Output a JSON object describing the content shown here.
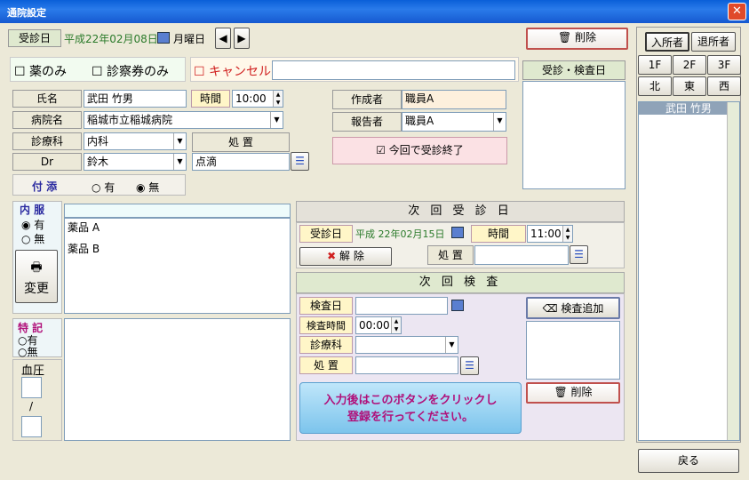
{
  "window": {
    "title": "通院設定",
    "close": "✕"
  },
  "header": {
    "visit_label": "受診日",
    "visit_date": "平成22年02月08日",
    "weekday": "月曜日",
    "prev": "◀",
    "next": "▶",
    "delete_label": "削除"
  },
  "checks": {
    "drug_only": "薬のみ",
    "ticket_only": "診察券のみ",
    "cancel": "キャンセル"
  },
  "patient": {
    "name_label": "氏名",
    "name": "武田 竹男",
    "time_label": "時間",
    "time": "10:00",
    "hospital_label": "病院名",
    "hospital": "稲城市立稲城病院",
    "dept_label": "診療科",
    "dept": "内科",
    "treat_label": "処 置",
    "dr_label": "Dr",
    "dr": "鈴木",
    "treat": "点滴",
    "author_label": "作成者",
    "author": "職員A",
    "reporter_label": "報告者",
    "reporter": "職員A",
    "finish": "今回で受診終了"
  },
  "attend": {
    "label": "付 添",
    "yes": "有",
    "no": "無"
  },
  "visit_list_header": "受診・検査日",
  "meds": {
    "label": "内 服",
    "yes": "有",
    "no": "無",
    "change": "変更",
    "items": [
      "薬品 A",
      "薬品 B"
    ]
  },
  "special": {
    "label": "特 記",
    "yes": "有",
    "no": "無"
  },
  "bp": {
    "label": "血圧",
    "sep": "/"
  },
  "next_visit": {
    "title": "次 回 受 診 日",
    "date_label": "受診日",
    "date": "平成 22年02月15日",
    "time_label": "時間",
    "time": "11:00",
    "cancel": "解 除",
    "treat_label": "処 置"
  },
  "next_exam": {
    "title": "次 回 検 査",
    "date_label": "検査日",
    "time_label": "検査時間",
    "time": "00:00",
    "dept_label": "診療科",
    "treat_label": "処 置",
    "add": "検査追加",
    "delete": "削除",
    "message": "入力後はこのボタンをクリックし\n登録を行ってください。"
  },
  "side": {
    "tab_in": "入所者",
    "tab_out": "退所者",
    "floors": [
      "1F",
      "2F",
      "3F"
    ],
    "areas": [
      "北",
      "東",
      "西"
    ],
    "residents": [
      "武田 竹男"
    ]
  },
  "footer": {
    "back": "戻る"
  }
}
